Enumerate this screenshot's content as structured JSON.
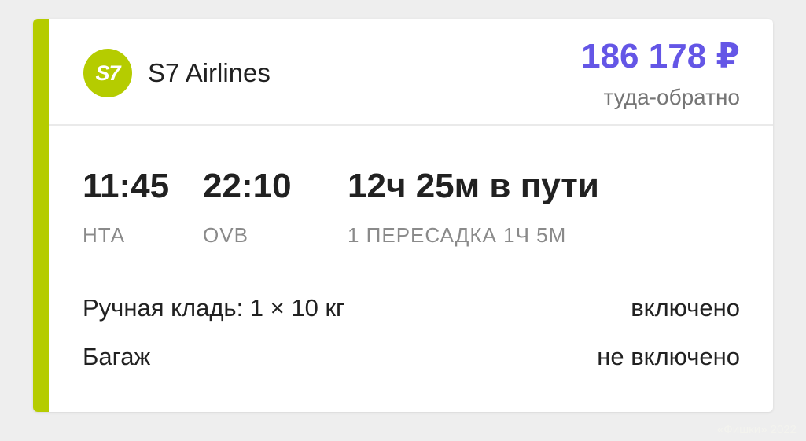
{
  "colors": {
    "accent": "#b5cc00",
    "logo_bg": "#b5cc00",
    "price": "#6456e6"
  },
  "airline": {
    "logo_text": "S7",
    "name": "S7 Airlines"
  },
  "price": {
    "amount": "186 178 ₽",
    "trip_type": "туда-обратно"
  },
  "flight": {
    "departure_time": "11:45",
    "departure_code": "НТА",
    "arrival_time": "22:10",
    "arrival_code": "OVB",
    "duration": "12ч 25м в пути",
    "stops": "1 ПЕРЕСАДКА 1Ч 5М"
  },
  "baggage": {
    "hand_luggage_label": "Ручная кладь: 1 × 10 кг",
    "hand_luggage_value": "включено",
    "checked_label": "Багаж",
    "checked_value": "не включено"
  },
  "watermark": "«Фишки» 2022"
}
